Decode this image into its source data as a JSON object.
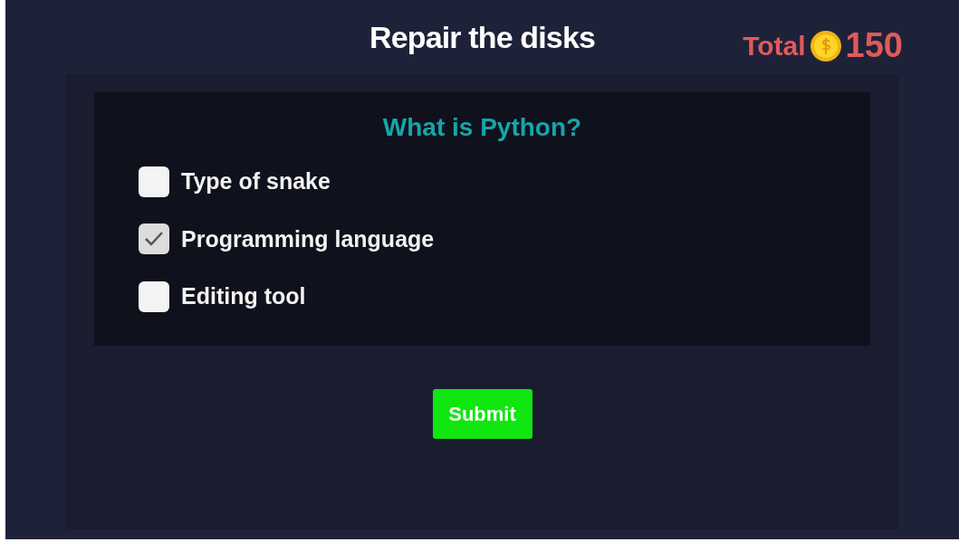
{
  "header": {
    "title": "Repair the disks",
    "total_label": "Total",
    "total_value": "150"
  },
  "question": {
    "text": "What is Python?",
    "options": [
      {
        "label": "Type of snake",
        "checked": false
      },
      {
        "label": "Programming language",
        "checked": true
      },
      {
        "label": "Editing tool",
        "checked": false
      }
    ]
  },
  "submit": {
    "label": "Submit"
  }
}
